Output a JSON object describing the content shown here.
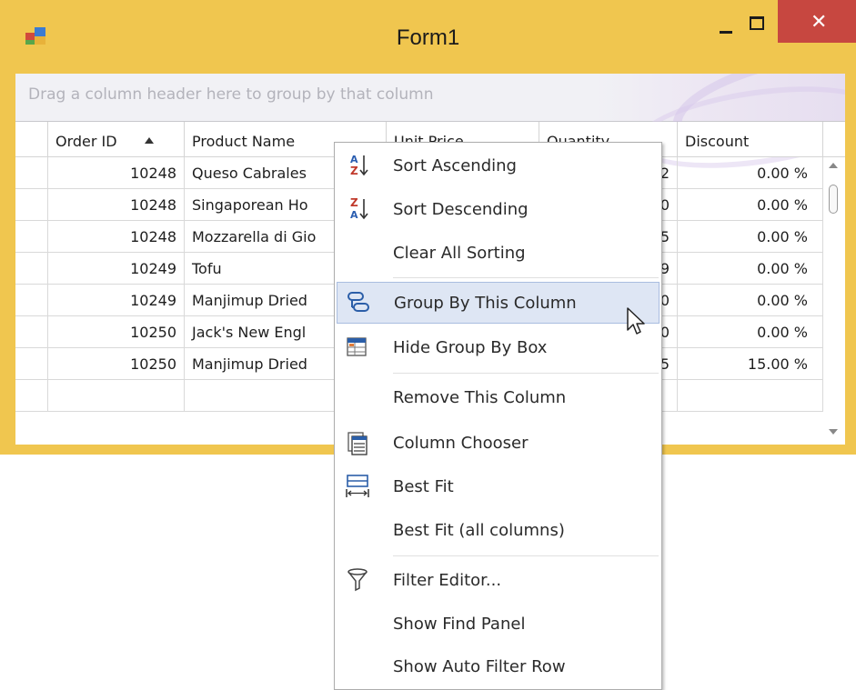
{
  "window": {
    "title": "Form1",
    "colors": {
      "frame": "#f0c64f",
      "close": "#c74740"
    }
  },
  "groupbox": {
    "hint": "Drag a column header here to group by that column"
  },
  "columns": [
    {
      "label": "Order ID",
      "sorted": "ascending"
    },
    {
      "label": "Product Name"
    },
    {
      "label": "Unit Price"
    },
    {
      "label": "Quantity"
    },
    {
      "label": "Discount"
    }
  ],
  "rows": [
    {
      "order_id": "10248",
      "product": "Queso Cabrales",
      "unit_price": "",
      "quantity": "12",
      "discount": "0.00 %"
    },
    {
      "order_id": "10248",
      "product": "Singaporean Ho",
      "unit_price": "",
      "quantity": "10",
      "discount": "0.00 %"
    },
    {
      "order_id": "10248",
      "product": "Mozzarella di Gio",
      "unit_price": "",
      "quantity": "5",
      "discount": "0.00 %"
    },
    {
      "order_id": "10249",
      "product": "Tofu",
      "unit_price": "",
      "quantity": "9",
      "discount": "0.00 %"
    },
    {
      "order_id": "10249",
      "product": "Manjimup Dried",
      "unit_price": "",
      "quantity": "40",
      "discount": "0.00 %"
    },
    {
      "order_id": "10250",
      "product": "Jack's New Engl",
      "unit_price": "",
      "quantity": "10",
      "discount": "0.00 %"
    },
    {
      "order_id": "10250",
      "product": "Manjimup Dried",
      "unit_price": "",
      "quantity": "35",
      "discount": "15.00 %"
    }
  ],
  "context_menu": {
    "items": [
      {
        "label": "Sort Ascending",
        "icon": "sort-ascending-icon"
      },
      {
        "label": "Sort Descending",
        "icon": "sort-descending-icon"
      },
      {
        "label": "Clear All Sorting",
        "icon": ""
      },
      {
        "label": "Group By This Column",
        "icon": "group-by-icon",
        "highlighted": true
      },
      {
        "label": "Hide Group By Box",
        "icon": "group-box-icon"
      },
      {
        "label": "Remove This Column",
        "icon": ""
      },
      {
        "label": "Column Chooser",
        "icon": "column-chooser-icon"
      },
      {
        "label": "Best Fit",
        "icon": "best-fit-icon"
      },
      {
        "label": "Best Fit (all columns)",
        "icon": ""
      },
      {
        "label": "Filter Editor...",
        "icon": "filter-icon"
      },
      {
        "label": "Show Find Panel",
        "icon": ""
      },
      {
        "label": "Show Auto Filter Row",
        "icon": ""
      }
    ],
    "colors": {
      "highlight_bg": "#dee6f4",
      "highlight_border": "#a9bde0"
    }
  }
}
